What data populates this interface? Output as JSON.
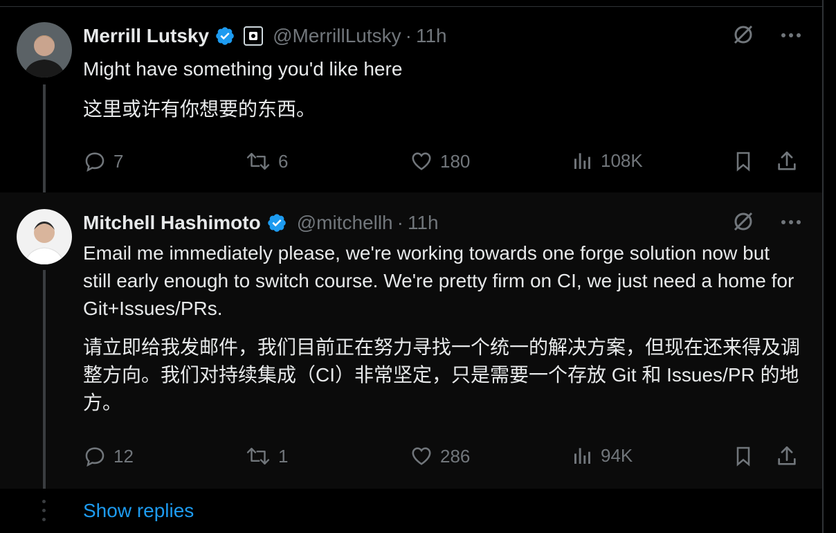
{
  "tweets": [
    {
      "name": "Merrill Lutsky",
      "handle": "@MerrillLutsky",
      "separator": "·",
      "time": "11h",
      "text_en": "Might have something you'd like here",
      "text_zh": "这里或许有你想要的东西。",
      "replies": "7",
      "retweets": "6",
      "likes": "180",
      "views": "108K"
    },
    {
      "name": "Mitchell Hashimoto",
      "handle": "@mitchellh",
      "separator": "·",
      "time": "11h",
      "text_en": "Email me immediately please, we're working towards one forge solution now but still early enough to switch course. We're pretty firm on CI, we just need a home for Git+Issues/PRs.",
      "text_zh": "请立即给我发邮件，我们目前正在努力寻找一个统一的解决方案，但现在还来得及调整方向。我们对持续集成（CI）非常坚定，只是需要一个存放 Git 和 Issues/PR 的地方。",
      "replies": "12",
      "retweets": "1",
      "likes": "286",
      "views": "94K"
    }
  ],
  "show_replies": "Show replies",
  "colors": {
    "accent": "#1d9bf0",
    "muted": "#71767b",
    "text": "#e7e9ea",
    "background": "#000000"
  },
  "icons": [
    "verified-badge-icon",
    "affiliate-badge-icon",
    "grok-icon",
    "more-icon",
    "reply-icon",
    "retweet-icon",
    "like-icon",
    "views-icon",
    "bookmark-icon",
    "share-icon"
  ]
}
